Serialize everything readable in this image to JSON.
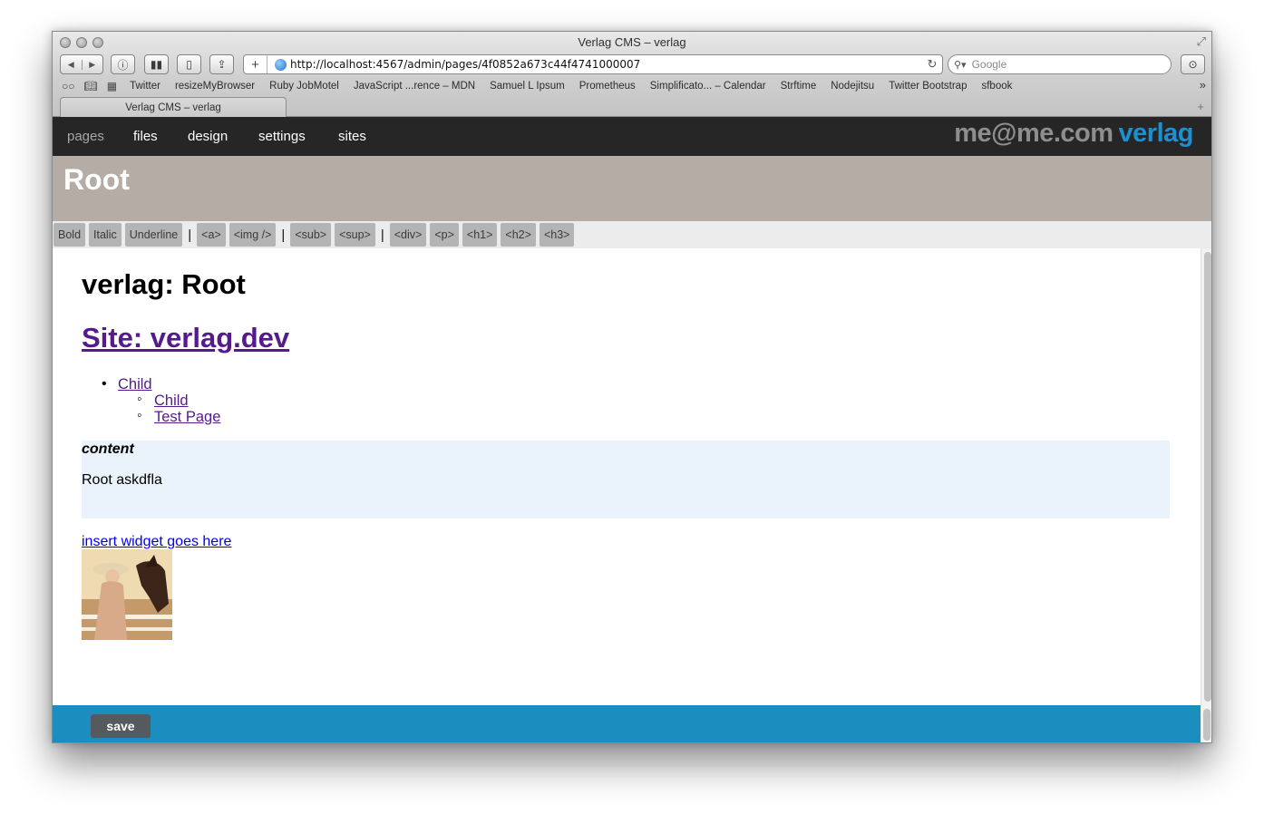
{
  "window": {
    "title": "Verlag CMS – verlag"
  },
  "toolbar": {
    "url": "http://localhost:4567/admin/pages/4f0852a673c44f4741000007",
    "search_placeholder": "Google",
    "back_glyph": "◀",
    "forward_glyph": "▶",
    "add_glyph": "+",
    "reload_glyph": "↻"
  },
  "bookmarks": {
    "items": [
      "Twitter",
      "resizeMyBrowser",
      "Ruby JobMotel",
      "JavaScript ...rence – MDN",
      "Samuel L Ipsum",
      "Prometheus",
      "Simplificato... – Calendar",
      "Strftime",
      "Nodejitsu",
      "Twitter Bootstrap",
      "sfbook"
    ],
    "more_glyph": "»"
  },
  "tab": {
    "label": "Verlag CMS – verlag"
  },
  "app": {
    "nav": [
      "pages",
      "files",
      "design",
      "settings",
      "sites"
    ],
    "brand_user": "me@me.com",
    "brand_app": "verlag",
    "header_title": "Root",
    "editbar": {
      "group1": [
        "Bold",
        "Italic",
        "Underline"
      ],
      "group2": [
        "<a>",
        "<img />"
      ],
      "group3": [
        "<sub>",
        "<sup>"
      ],
      "group4": [
        "<div>",
        "<p>",
        "<h1>",
        "<h2>",
        "<h3>"
      ],
      "separator": "|"
    },
    "content": {
      "heading": "verlag: Root",
      "site_link": "Site: verlag.dev",
      "tree": {
        "child": "Child",
        "subitems": [
          "Child",
          "Test Page"
        ]
      },
      "region_label": "content",
      "region_text": "Root askdfla",
      "widget_link": "insert widget goes here"
    },
    "save_label": "save"
  },
  "colors": {
    "nav_bg": "#262626",
    "brand_accent": "#1e8fd0",
    "header_bg": "#b5ada5",
    "footer_bg": "#1b8ebf",
    "region_bg": "#eaf3fb"
  }
}
